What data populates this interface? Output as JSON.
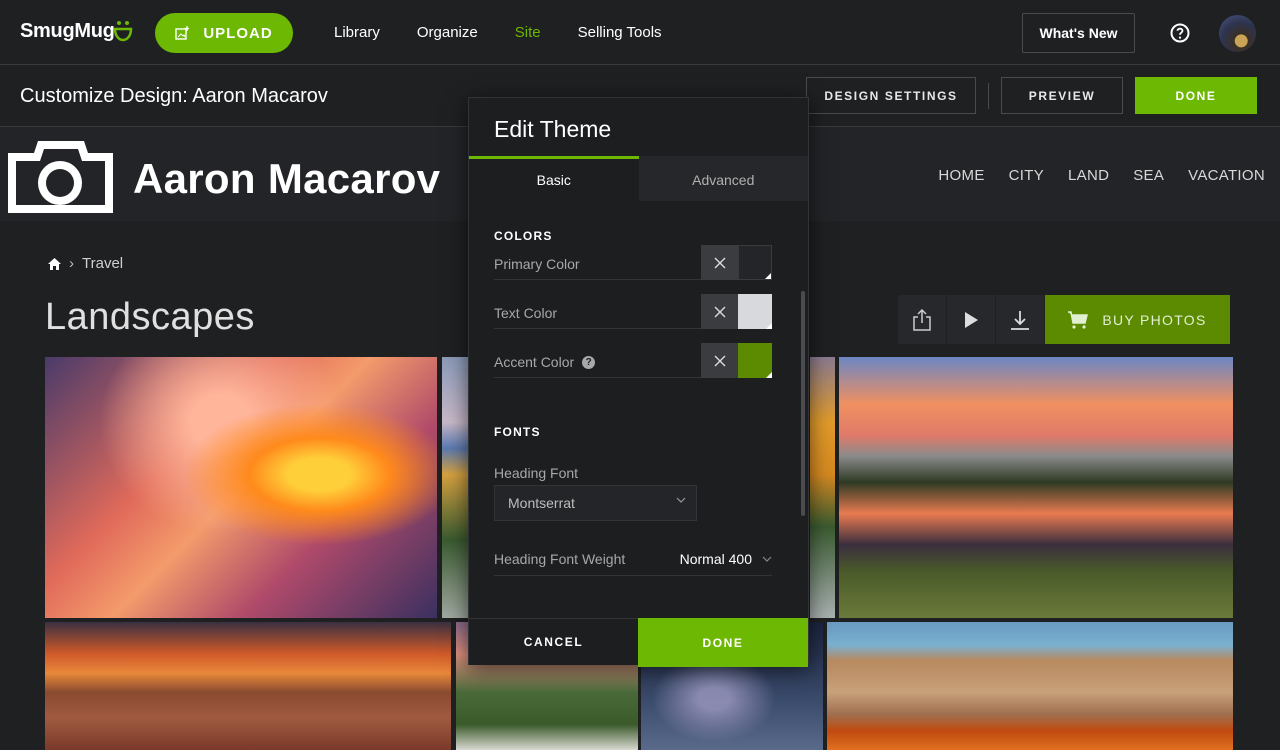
{
  "app": {
    "brand": "SmugMug",
    "upload_label": "UPLOAD",
    "nav": [
      {
        "label": "Library",
        "active": false
      },
      {
        "label": "Organize",
        "active": false
      },
      {
        "label": "Site",
        "active": true
      },
      {
        "label": "Selling Tools",
        "active": false
      }
    ],
    "whats_new_label": "What's New",
    "help_icon": "help-circle-icon",
    "accent_color": "#6db802"
  },
  "subbar": {
    "title": "Customize Design: Aaron Macarov",
    "design_settings_label": "DESIGN SETTINGS",
    "preview_label": "PREVIEW",
    "done_label": "DONE"
  },
  "site": {
    "name": "Aaron Macarov",
    "logo_icon": "camera-icon",
    "nav": [
      "HOME",
      "CITY",
      "LAND",
      "SEA",
      "VACATION"
    ],
    "breadcrumb": {
      "home_icon": "home-icon",
      "items": [
        "Travel"
      ]
    },
    "gallery_title": "Landscapes",
    "actions": {
      "share_icon": "share-icon",
      "slideshow_icon": "play-icon",
      "download_icon": "download-icon",
      "buy_label": "BUY PHOTOS",
      "buy_color": "#5c8a00"
    }
  },
  "modal": {
    "title": "Edit Theme",
    "tabs": [
      {
        "label": "Basic",
        "active": true
      },
      {
        "label": "Advanced",
        "active": false
      }
    ],
    "colors_section": "COLORS",
    "colors": [
      {
        "label": "Primary Color",
        "value": "#242528",
        "help": false
      },
      {
        "label": "Text Color",
        "value": "#d8d9dc",
        "help": false
      },
      {
        "label": "Accent Color",
        "value": "#5c8a00",
        "help": true
      }
    ],
    "fonts_section": "FONTS",
    "heading_font_label": "Heading Font",
    "heading_font_value": "Montserrat",
    "heading_weight_label": "Heading Font Weight",
    "heading_weight_value": "Normal 400",
    "cancel_label": "CANCEL",
    "done_label": "DONE"
  }
}
